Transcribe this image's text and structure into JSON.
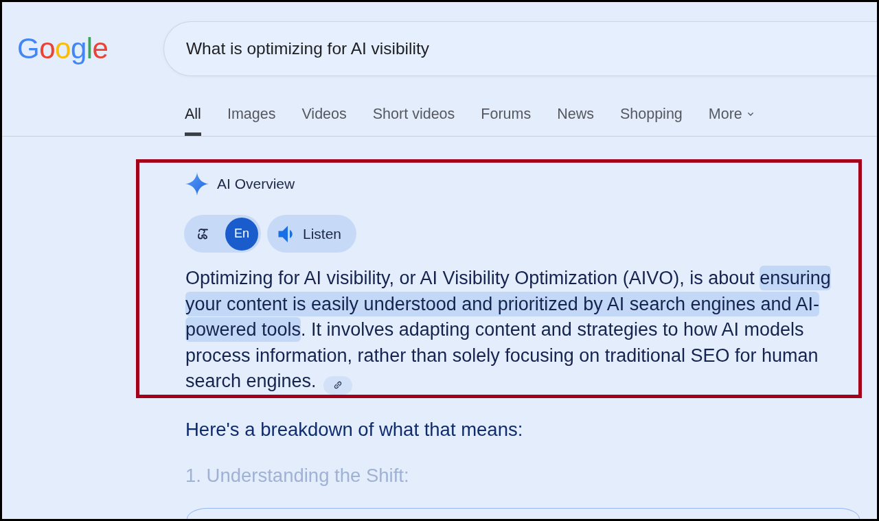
{
  "logo": {
    "text": "Google"
  },
  "search": {
    "value": "What is optimizing for AI visibility"
  },
  "tabs": [
    {
      "label": "All",
      "selected": true,
      "kind": "tab"
    },
    {
      "label": "Images",
      "selected": false,
      "kind": "tab"
    },
    {
      "label": "Videos",
      "selected": false,
      "kind": "tab"
    },
    {
      "label": "Short videos",
      "selected": false,
      "kind": "tab"
    },
    {
      "label": "Forums",
      "selected": false,
      "kind": "tab"
    },
    {
      "label": "News",
      "selected": false,
      "kind": "tab"
    },
    {
      "label": "Shopping",
      "selected": false,
      "kind": "tab"
    },
    {
      "label": "More",
      "selected": false,
      "kind": "menu"
    }
  ],
  "ai_overview": {
    "title": "AI Overview",
    "language_toggle": [
      {
        "kind": "script",
        "selected": false
      },
      {
        "kind": "text",
        "label": "En",
        "selected": true
      }
    ],
    "listen_button": {
      "label": "Listen"
    },
    "summary": [
      {
        "text": "Optimizing for AI visibility, or AI Visibility Optimization (AIVO), is about ",
        "highlighted": false
      },
      {
        "text": "ensuring your content is easily understood and prioritized by AI search engines and AI-powered tools",
        "highlighted": true
      },
      {
        "text": ". It involves adapting content and strategies to how AI models process information, rather than solely focusing on traditional SEO for human search engines.",
        "highlighted": false
      }
    ],
    "source_link": true
  },
  "breakdown_intro": "Here's a breakdown of what that means:",
  "faded_heading": "1. Understanding the Shift:"
}
